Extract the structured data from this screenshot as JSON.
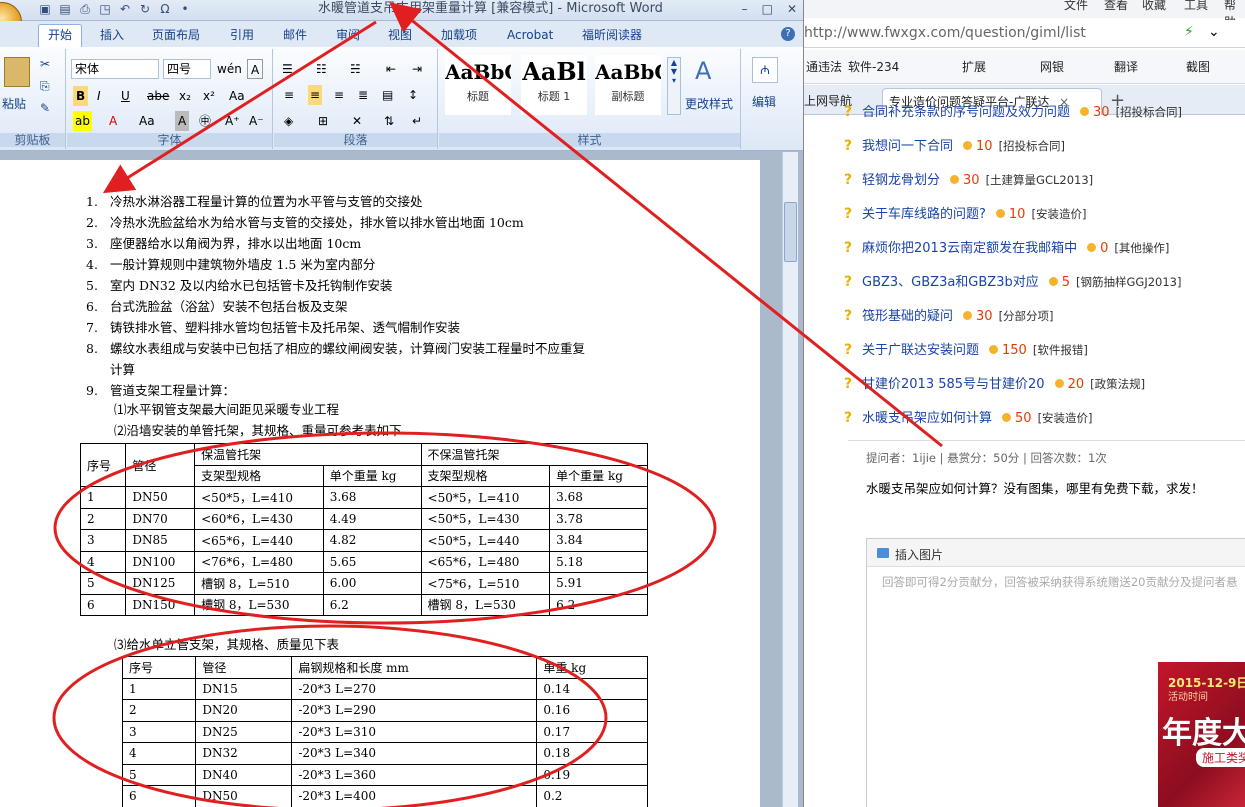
{
  "word": {
    "title": "水暖管道支吊支用架重量计算 [兼容模式] - Microsoft Word",
    "window_controls": [
      "–",
      "□",
      "✕"
    ],
    "tabs": [
      "开始",
      "插入",
      "页面布局",
      "引用",
      "邮件",
      "审阅",
      "视图",
      "加载项",
      "Acrobat",
      "福昕阅读器"
    ],
    "ribbon": {
      "clipboard": {
        "paste": "粘贴",
        "label": "剪贴板"
      },
      "font": {
        "name": "宋体",
        "size": "四号",
        "label": "字体"
      },
      "paragraph": {
        "label": "段落"
      },
      "styles": {
        "items": [
          {
            "preview": "AaBbC",
            "name": "标题"
          },
          {
            "preview": "AaBl",
            "name": "标题 1"
          },
          {
            "preview": "AaBbC",
            "name": "副标题"
          }
        ],
        "change": "更改样式",
        "label": "样式"
      },
      "editing": {
        "label": "编辑"
      }
    },
    "list": [
      {
        "n": "1.",
        "text": "冷热水淋浴器工程量计算的位置为水平管与支管的交接处"
      },
      {
        "n": "2.",
        "text": "冷热水洗脸盆给水为给水管与支管的交接处，排水管以排水管出地面 10cm"
      },
      {
        "n": "3.",
        "text": "座便器给水以角阀为界，排水以出地面 10cm"
      },
      {
        "n": "4.",
        "text": "一般计算规则中建筑物外墙皮 1.5 米为室内部分"
      },
      {
        "n": "5.",
        "text": "室内 DN32 及以内给水已包括管卡及托钩制作安装"
      },
      {
        "n": "6.",
        "text": "台式洗脸盆（浴盆）安装不包括台板及支架"
      },
      {
        "n": "7.",
        "text": "铸铁排水管、塑料排水管均包括管卡及托吊架、透气帽制作安装"
      },
      {
        "n": "8.",
        "text": "螺纹水表组成与安装中已包括了相应的螺纹闸阀安装，计算阀门安装工程量时不应重复"
      },
      {
        "n": "",
        "text": "计算"
      },
      {
        "n": "9.",
        "text": "管道支架工程量计算："
      }
    ],
    "sub1": "⑴水平钢管支架最大间距见采暖专业工程",
    "sub2": "⑵沿墙安装的单管托架，其规格、重量可参考表如下",
    "table1": {
      "h_no": "序号",
      "h_pipe": "管径",
      "h_ins": "保温管托架",
      "h_noins": "不保温管托架",
      "h_spec": "支架型规格",
      "h_wt": "单个重量 kg",
      "rows": [
        [
          "1",
          "DN50",
          "<50*5，L=410",
          "3.68",
          "<50*5，L=410",
          "3.68"
        ],
        [
          "2",
          "DN70",
          "<60*6，L=430",
          "4.49",
          "<50*5，L=430",
          "3.78"
        ],
        [
          "3",
          "DN85",
          "<65*6，L=440",
          "4.82",
          "<50*5，L=440",
          "3.84"
        ],
        [
          "4",
          "DN100",
          "<76*6，L=480",
          "5.65",
          "<65*6，L=480",
          "5.18"
        ],
        [
          "5",
          "DN125",
          "槽钢 8，L=510",
          "6.00",
          "<75*6，L=510",
          "5.91"
        ],
        [
          "6",
          "DN150",
          "槽钢 8，L=530",
          "6.2",
          "槽钢 8，L=530",
          "6.2"
        ]
      ]
    },
    "sub3": "⑶给水单立管支架，其规格、质量见下表",
    "table2": {
      "headers": [
        "序号",
        "管径",
        "扁钢规格和长度 mm",
        "单重 kg"
      ],
      "rows": [
        [
          "1",
          "DN15",
          "-20*3   L=270",
          "0.14"
        ],
        [
          "2",
          "DN20",
          "-20*3   L=290",
          "0.16"
        ],
        [
          "3",
          "DN25",
          "-20*3   L=310",
          "0.17"
        ],
        [
          "4",
          "DN32",
          "-20*3   L=340",
          "0.18"
        ],
        [
          "5",
          "DN40",
          "-20*3   L=360",
          "0.19"
        ],
        [
          "6",
          "DN50",
          "-20*3   L=400",
          "0.2"
        ]
      ]
    }
  },
  "browser": {
    "menu": [
      "文件",
      "查看",
      "收藏",
      "工具",
      "帮助"
    ],
    "url": "http://www.fwxgx.com/question/giml/list",
    "bookmarks": [
      "通违法",
      "软件-234",
      "扩展",
      "网银",
      "翻译",
      "截图"
    ],
    "tabs": {
      "nav": "上网导航",
      "active": "专业造价问题答疑平台-广联达"
    },
    "questions": [
      {
        "title": "合同补充条款的序号问题及效力问题",
        "points": "30",
        "cat": "[招投标合同]"
      },
      {
        "title": "我想问一下合同",
        "points": "10",
        "cat": "[招投标合同]"
      },
      {
        "title": "轻钢龙骨划分",
        "points": "30",
        "cat": "[土建算量GCL2013]"
      },
      {
        "title": "关于车库线路的问题?",
        "points": "10",
        "cat": "[安装造价]"
      },
      {
        "title": "麻烦你把2013云南定额发在我邮箱中",
        "points": "0",
        "cat": "[其他操作]"
      },
      {
        "title": "GBZ3、GBZ3a和GBZ3b对应",
        "points": "5",
        "cat": "[钢筋抽样GGJ2013]"
      },
      {
        "title": "筏形基础的疑问",
        "points": "30",
        "cat": "[分部分项]"
      },
      {
        "title": "关于广联达安装问题",
        "points": "150",
        "cat": "[软件报错]"
      },
      {
        "title": "甘建价2013 585号与甘建价20",
        "points": "20",
        "cat": "[政策法规]"
      },
      {
        "title": "水暖支吊架应如何计算",
        "points": "50",
        "cat": "[安装造价]"
      }
    ],
    "meta": "提问者：1ijie  |  悬赏分：50分  |  回答次数：1次",
    "question_text": "水暖支吊架应如何计算？没有图集，哪里有免费下载，求发！",
    "insert_image": "插入图片",
    "placeholder": "回答即可得2分贡献分，回答被采纳获得系统赠送20贡献分及提问者悬",
    "ad": {
      "date": "2015-12-9日",
      "sub": "活动时间",
      "big": "年度大",
      "btn": "施工类奖"
    }
  },
  "colors": {
    "annotation": "#e02020",
    "ribbon_text": "#15428b"
  }
}
